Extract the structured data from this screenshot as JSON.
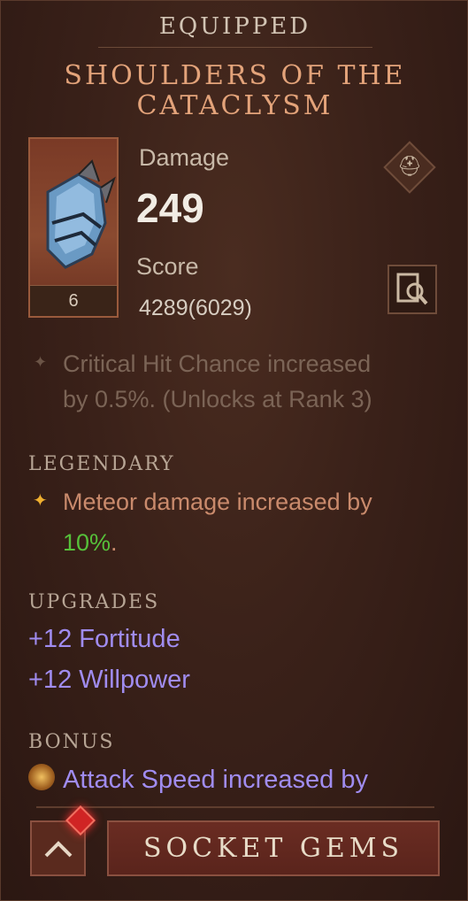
{
  "header": {
    "label": "EQUIPPED"
  },
  "item": {
    "name": "SHOULDERS OF THE CATACLYSM",
    "level": "6",
    "icon": "shoulder-armor-icon"
  },
  "stats": {
    "damage_label": "Damage",
    "damage_value": "249",
    "score_label": "Score",
    "score_value": "4289(6029)"
  },
  "locked_affix": {
    "line1": "Critical Hit Chance increased",
    "line2": "by 0.5%. (Unlocks at Rank 3)"
  },
  "legendary": {
    "title": "LEGENDARY",
    "line1": "Meteor damage increased by",
    "value": "10%",
    "suffix": "."
  },
  "upgrades": {
    "title": "UPGRADES",
    "items": [
      "+12 Fortitude",
      "+12 Willpower"
    ]
  },
  "bonus": {
    "title": "BONUS",
    "line1": "Attack Speed increased by"
  },
  "buttons": {
    "socket_gems": "SOCKET GEMS",
    "back_icon": "chevron-up-icon"
  },
  "colors": {
    "legendary": "#c98a6c",
    "highlight": "#56c03a",
    "upgrade": "#a08cf0"
  }
}
